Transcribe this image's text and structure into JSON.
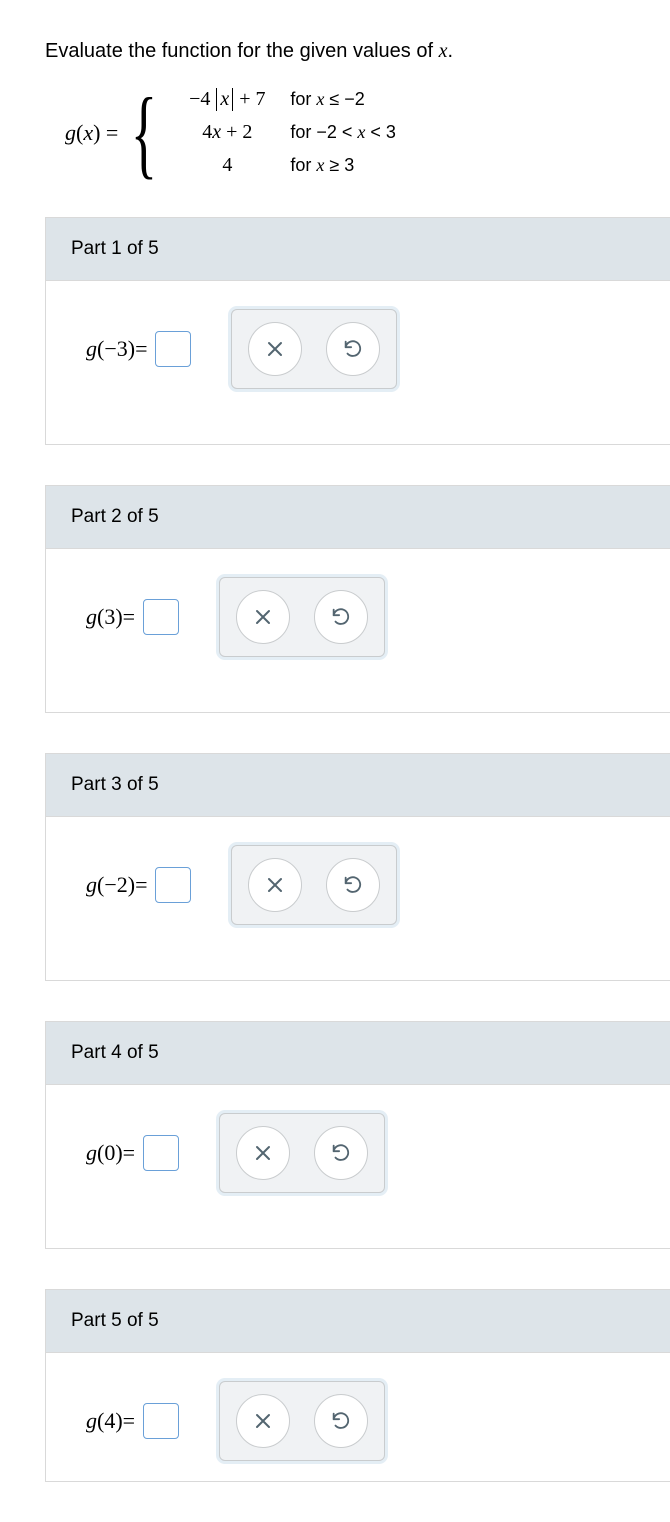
{
  "prompt": "Evaluate the function for the given values of ",
  "prompt_var": "x",
  "prompt_end": ".",
  "func": {
    "lhs_g": "g",
    "lhs_x": "x",
    "equals": " = ",
    "case1": {
      "coef": "−4 ",
      "var": "x",
      "tail": " + 7",
      "for": "for ",
      "cond_var": "x",
      "cond_rel": " ≤ −2"
    },
    "case2": {
      "expr_a": "4",
      "expr_var": "x",
      "expr_b": " + 2",
      "for": "for ",
      "cond": "−2 < ",
      "cond_var": "x",
      "cond2": " < 3"
    },
    "case3": {
      "expr": "4",
      "for": "for ",
      "cond_var": "x",
      "cond_rel": " ≥ 3"
    }
  },
  "parts": [
    {
      "header": "Part 1 of 5",
      "g": "g",
      "arg": "(−3)",
      "eq": " = "
    },
    {
      "header": "Part 2 of 5",
      "g": "g",
      "arg": "(3)",
      "eq": " = "
    },
    {
      "header": "Part 3 of 5",
      "g": "g",
      "arg": "(−2)",
      "eq": " = "
    },
    {
      "header": "Part 4 of 5",
      "g": "g",
      "arg": "(0)",
      "eq": " = "
    },
    {
      "header": "Part 5 of 5",
      "g": "g",
      "arg": "(4)",
      "eq": " = "
    }
  ]
}
